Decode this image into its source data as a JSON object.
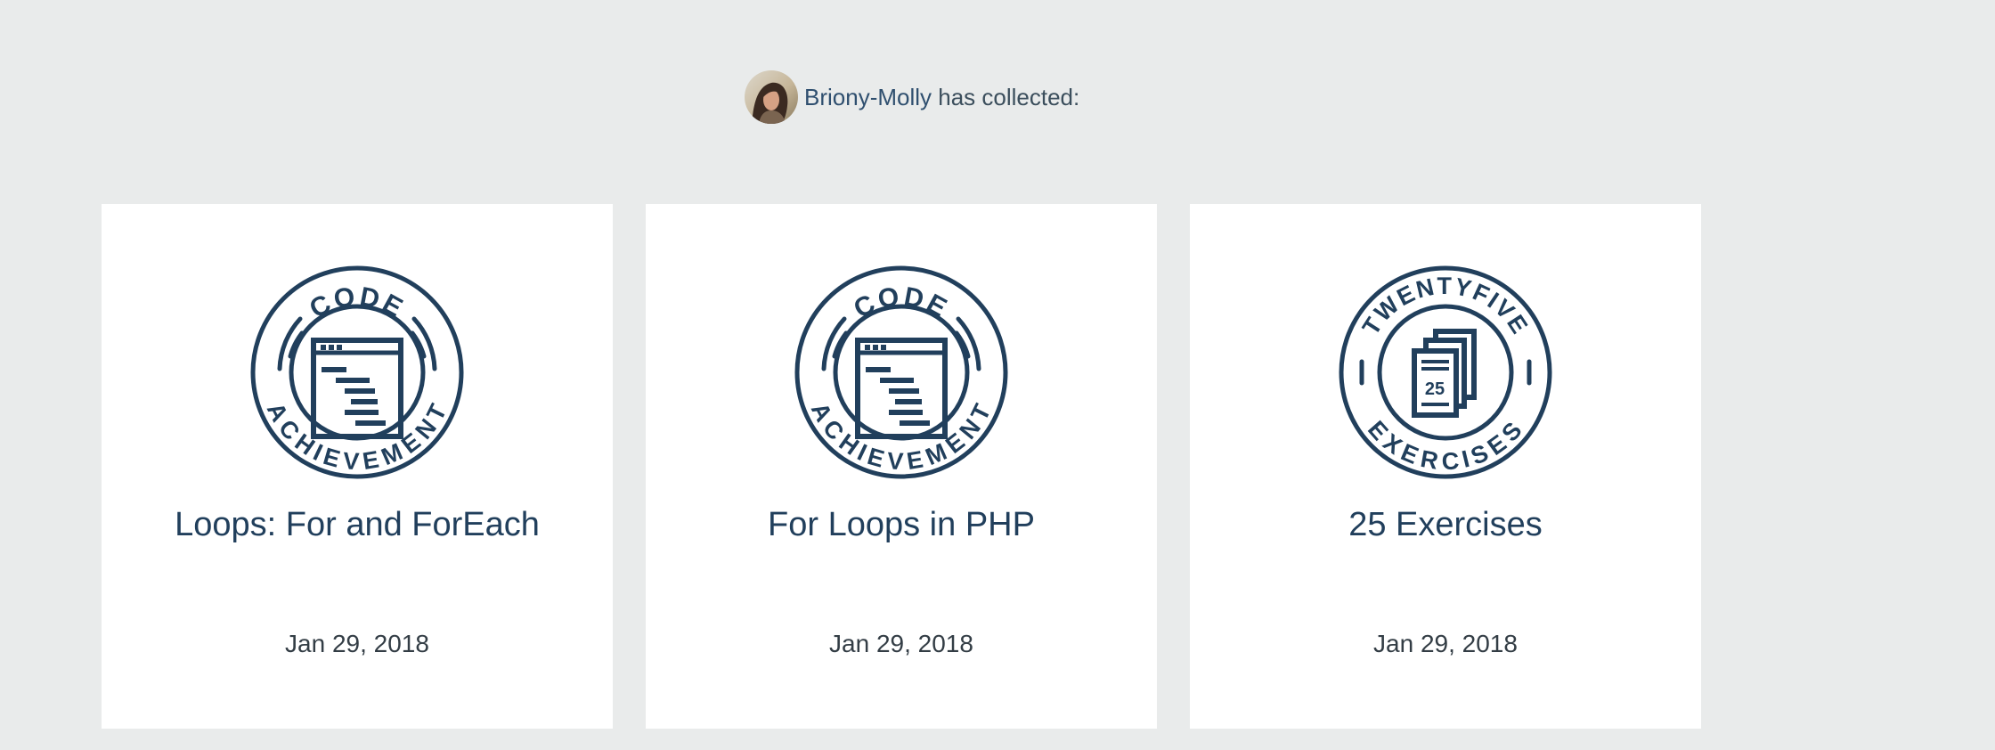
{
  "header": {
    "user_name": "Briony-Molly",
    "collected_text": " has collected:"
  },
  "colors": {
    "background": "#e9ebeb",
    "card": "#ffffff",
    "badge": "#213f5c",
    "text": "#213a4f"
  },
  "achievements": [
    {
      "title": "Loops: For and ForEach",
      "date": "Jan 29, 2018",
      "badge_top": "CODE",
      "badge_bottom": "ACHIEVEMENT",
      "icon": "code-window-icon"
    },
    {
      "title": "For Loops in PHP",
      "date": "Jan 29, 2018",
      "badge_top": "CODE",
      "badge_bottom": "ACHIEVEMENT",
      "icon": "code-window-icon"
    },
    {
      "title": "25 Exercises",
      "date": "Jan 29, 2018",
      "badge_top": "TWENTYFIVE",
      "badge_bottom": "EXERCISES",
      "badge_number": "25",
      "icon": "document-stack-icon"
    }
  ]
}
